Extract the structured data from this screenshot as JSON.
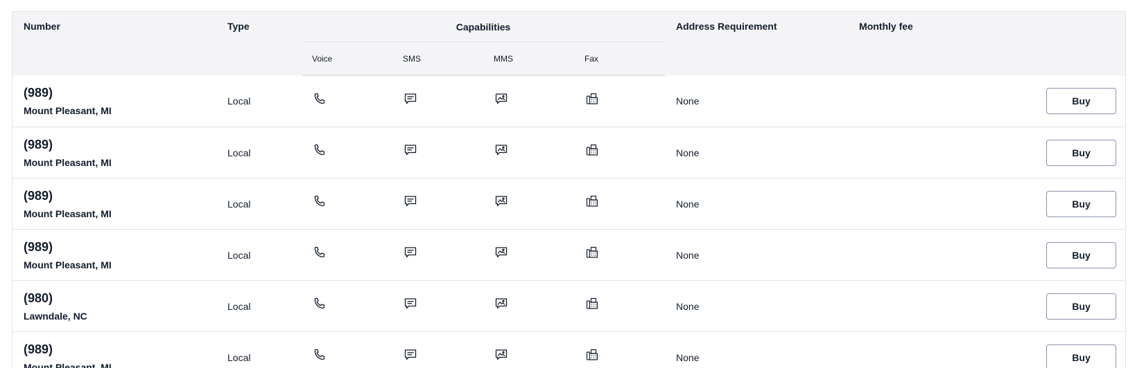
{
  "table": {
    "headers": {
      "number": "Number",
      "type": "Type",
      "capabilities": "Capabilities",
      "address": "Address Requirement",
      "fee": "Monthly fee"
    },
    "capability_headers": {
      "voice": "Voice",
      "sms": "SMS",
      "mms": "MMS",
      "fax": "Fax"
    },
    "rows": [
      {
        "area": "(989)",
        "location": "Mount Pleasant, MI",
        "type": "Local",
        "address": "None",
        "buy": "Buy"
      },
      {
        "area": "(989)",
        "location": "Mount Pleasant, MI",
        "type": "Local",
        "address": "None",
        "buy": "Buy"
      },
      {
        "area": "(989)",
        "location": "Mount Pleasant, MI",
        "type": "Local",
        "address": "None",
        "buy": "Buy"
      },
      {
        "area": "(989)",
        "location": "Mount Pleasant, MI",
        "type": "Local",
        "address": "None",
        "buy": "Buy"
      },
      {
        "area": "(980)",
        "location": "Lawndale, NC",
        "type": "Local",
        "address": "None",
        "buy": "Buy"
      },
      {
        "area": "(989)",
        "location": "Mount Pleasant, MI",
        "type": "Local",
        "address": "None",
        "buy": "Buy"
      }
    ],
    "icons": {
      "voice": "phone-icon",
      "sms": "sms-icon",
      "mms": "mms-icon",
      "fax": "fax-icon"
    }
  }
}
